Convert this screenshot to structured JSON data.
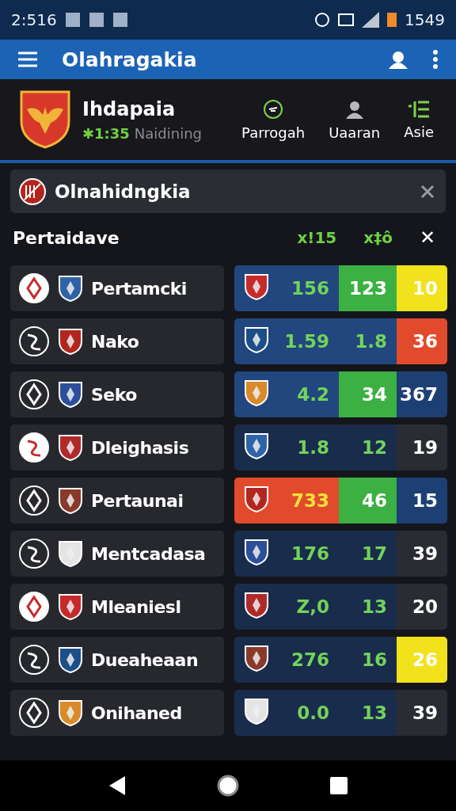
{
  "status_bar": {
    "time": "2:516",
    "battery_text": "1549"
  },
  "app_bar": {
    "title": "Olahragakia"
  },
  "team_header": {
    "name": "Ihdapaia",
    "score": "✱1:35",
    "subtitle": "Naidining",
    "tabs": [
      {
        "label": "Parrogah",
        "kind": "target"
      },
      {
        "label": "Uaaran",
        "kind": "person"
      },
      {
        "label": "Asie",
        "kind": "list"
      }
    ]
  },
  "banner": {
    "title": "Olnahidngkia"
  },
  "section": {
    "title": "Pertaidave",
    "column_1": "x!15",
    "column_2": "x‡ô",
    "close": "✕"
  },
  "rows": [
    {
      "name": "Pertamcki",
      "cells": [
        {
          "value": "156",
          "color": "#22467e"
        },
        {
          "value": "123",
          "color": "#3cb043"
        },
        {
          "value": "10",
          "color": "#f2e21c"
        }
      ]
    },
    {
      "name": "Nako",
      "cells": [
        {
          "value": "1.59",
          "color": "#22467e"
        },
        {
          "value": "1.8",
          "color": "#22467e"
        },
        {
          "value": "36",
          "color": "#e24a2c"
        }
      ]
    },
    {
      "name": "Seko",
      "cells": [
        {
          "value": "4.2",
          "color": "#22467e"
        },
        {
          "value": "34",
          "color": "#3cb043"
        },
        {
          "value": "367",
          "color": "#1d3f73"
        }
      ]
    },
    {
      "name": "Dleighasis",
      "cells": [
        {
          "value": "1.8",
          "color": "#1a2c4c"
        },
        {
          "value": "12",
          "color": "#1a2c4c"
        },
        {
          "value": "19",
          "color": "#2a2c33"
        }
      ]
    },
    {
      "name": "Pertaunai",
      "cells": [
        {
          "value": "733",
          "color": "#e24a2c"
        },
        {
          "value": "46",
          "color": "#3cb043"
        },
        {
          "value": "15",
          "color": "#1d3f73"
        }
      ]
    },
    {
      "name": "Mentcadasa",
      "cells": [
        {
          "value": "176",
          "color": "#1a2c4c"
        },
        {
          "value": "17",
          "color": "#1a2c4c"
        },
        {
          "value": "39",
          "color": "#2a2c33"
        }
      ]
    },
    {
      "name": "Mleaniesl",
      "cells": [
        {
          "value": "Z,0",
          "color": "#1a2c4c"
        },
        {
          "value": "13",
          "color": "#1a2c4c"
        },
        {
          "value": "20",
          "color": "#2a2c33"
        }
      ]
    },
    {
      "name": "Dueaheaan",
      "cells": [
        {
          "value": "276",
          "color": "#1a2c4c"
        },
        {
          "value": "16",
          "color": "#1a2c4c"
        },
        {
          "value": "26",
          "color": "#f2e21c"
        }
      ]
    },
    {
      "name": "Onihaned",
      "cells": [
        {
          "value": "0.0",
          "color": "#1a2c4c"
        },
        {
          "value": "13",
          "color": "#1a2c4c"
        },
        {
          "value": "39",
          "color": "#2a2c33"
        }
      ]
    }
  ]
}
